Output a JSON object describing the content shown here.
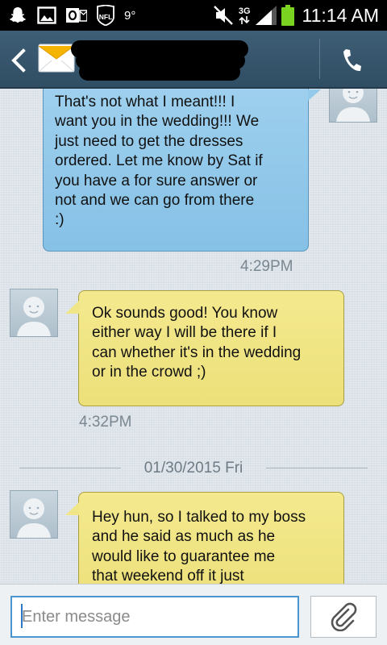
{
  "status_bar": {
    "temperature": "9°",
    "network": "3G",
    "time": "11:14 AM",
    "icons": [
      "snapchat-icon",
      "image-icon",
      "outlook-icon",
      "nfl-icon",
      "mute-icon",
      "signal-icon",
      "battery-icon"
    ],
    "nfl_text": "NFL"
  },
  "header": {
    "contact_name": "[redacted]",
    "icons": [
      "back-arrow-icon",
      "envelope-icon",
      "phone-icon"
    ]
  },
  "conversation": {
    "messages": [
      {
        "direction": "incoming-blue",
        "lines": [
          "That's not what I meant!!! I",
          "want you in the wedding!!! We",
          "just need to get the dresses",
          "ordered. Let me know by Sat if",
          "you have a for sure answer or",
          "not and we can go from there",
          ":)"
        ],
        "time": "4:29PM"
      },
      {
        "direction": "outgoing-yellow",
        "lines": [
          "Ok sounds good! You know",
          "either way I will be there if I",
          "can whether it's in the wedding",
          "or in the crowd ;)"
        ],
        "time": "4:32PM"
      },
      {
        "direction": "outgoing-yellow",
        "lines": [
          "Hey hun, so I talked to my boss",
          "and he said as much as he",
          "would like to guarantee me",
          "that weekend off it just"
        ]
      }
    ],
    "date_divider": "01/30/2015 Fri"
  },
  "composer": {
    "placeholder": "Enter message",
    "value": "",
    "attach_icon": "paperclip-icon"
  },
  "colors": {
    "header_bg": "#34536a",
    "blue_bubble": "#93c9eb",
    "yellow_bubble": "#f1e687",
    "input_border": "#4a94cf"
  }
}
